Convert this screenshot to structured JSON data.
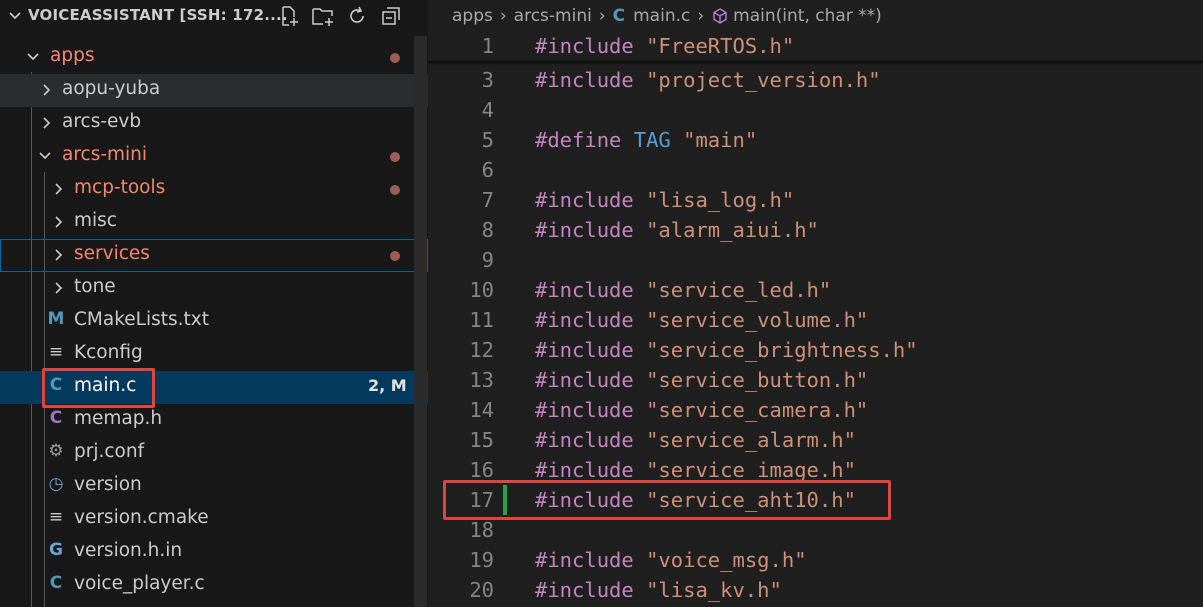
{
  "explorer": {
    "title": "VOICEASSISTANT [SSH: 172....",
    "actions": [
      "new-file-icon",
      "new-folder-icon",
      "refresh-icon",
      "collapse-all-icon"
    ],
    "items": [
      {
        "label": "apps",
        "modified": true,
        "kind": "folder-open"
      },
      {
        "label": "aopu-yuba",
        "modified": false,
        "kind": "folder"
      },
      {
        "label": "arcs-evb",
        "modified": false,
        "kind": "folder"
      },
      {
        "label": "arcs-mini",
        "modified": true,
        "kind": "folder-open"
      },
      {
        "label": "mcp-tools",
        "modified": true,
        "kind": "folder"
      },
      {
        "label": "misc",
        "modified": false,
        "kind": "folder"
      },
      {
        "label": "services",
        "modified": true,
        "kind": "folder"
      },
      {
        "label": "tone",
        "modified": false,
        "kind": "folder"
      },
      {
        "label": "CMakeLists.txt",
        "icon_text": "M",
        "kind": "file"
      },
      {
        "label": "Kconfig",
        "icon_text": "≡",
        "kind": "file"
      },
      {
        "label": "main.c",
        "icon_text": "C",
        "badge": "2, M",
        "kind": "file"
      },
      {
        "label": "memap.h",
        "icon_text": "C",
        "kind": "file"
      },
      {
        "label": "prj.conf",
        "icon_text": "⚙",
        "kind": "file"
      },
      {
        "label": "version",
        "icon_text": "◷",
        "kind": "file"
      },
      {
        "label": "version.cmake",
        "icon_text": "≡",
        "kind": "file"
      },
      {
        "label": "version.h.in",
        "icon_text": "G",
        "kind": "file"
      },
      {
        "label": "voice_player.c",
        "icon_text": "C",
        "kind": "file"
      }
    ]
  },
  "breadcrumb": {
    "parts": [
      "apps",
      "arcs-mini"
    ],
    "file_icon": "C",
    "file": "main.c",
    "symbol": "main(int, char **)"
  },
  "code": {
    "sticky": {
      "num": "1",
      "kw": "#include",
      "str": "\"FreeRTOS.h\""
    },
    "lines": [
      {
        "num": "3",
        "kw": "#include",
        "str": "\"project_version.h\""
      },
      {
        "num": "4"
      },
      {
        "num": "5",
        "kw": "#define",
        "mac": "TAG",
        "str": "\"main\""
      },
      {
        "num": "6"
      },
      {
        "num": "7",
        "kw": "#include",
        "str": "\"lisa_log.h\""
      },
      {
        "num": "8",
        "kw": "#include",
        "str": "\"alarm_aiui.h\""
      },
      {
        "num": "9"
      },
      {
        "num": "10",
        "kw": "#include",
        "str": "\"service_led.h\""
      },
      {
        "num": "11",
        "kw": "#include",
        "str": "\"service_volume.h\""
      },
      {
        "num": "12",
        "kw": "#include",
        "str": "\"service_brightness.h\""
      },
      {
        "num": "13",
        "kw": "#include",
        "str": "\"service_button.h\""
      },
      {
        "num": "14",
        "kw": "#include",
        "str": "\"service_camera.h\""
      },
      {
        "num": "15",
        "kw": "#include",
        "str": "\"service_alarm.h\""
      },
      {
        "num": "16",
        "kw": "#include",
        "str": "\"service_image.h\""
      },
      {
        "num": "17",
        "kw": "#include",
        "str": "\"service_aht10.h\""
      },
      {
        "num": "18"
      },
      {
        "num": "19",
        "kw": "#include",
        "str": "\"voice_msg.h\""
      },
      {
        "num": "20",
        "kw": "#include",
        "str": "\"lisa_kv.h\""
      }
    ]
  },
  "colors": {
    "keyword": "#c586c0",
    "string": "#ce9178",
    "macro": "#569cd6",
    "modified": "#f48771",
    "highlight_box": "#e0443e",
    "added_line": "#2ea043"
  }
}
